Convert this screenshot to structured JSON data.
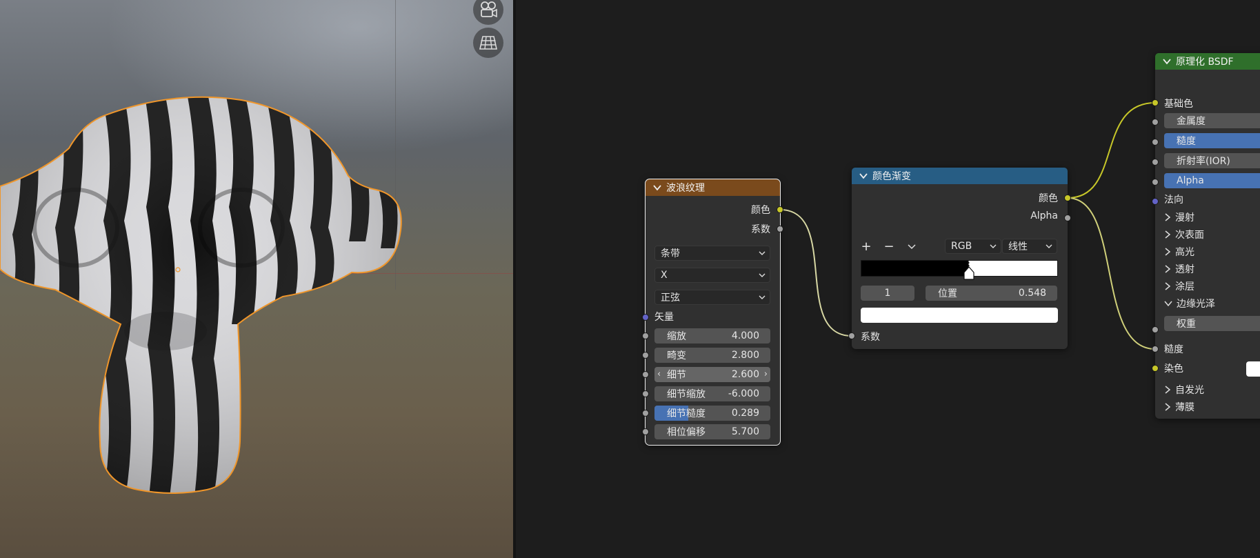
{
  "viewport": {
    "camera_icon": "camera-view-icon",
    "grid_icon": "perspective-grid-icon"
  },
  "wave_node": {
    "title": "波浪纹理",
    "outputs": [
      "颜色",
      "系数"
    ],
    "dropdowns": [
      "条带",
      "X",
      "正弦"
    ],
    "vector_input": "矢量",
    "fields": [
      {
        "label": "缩放",
        "value": "4.000"
      },
      {
        "label": "畸变",
        "value": "2.800"
      },
      {
        "label": "细节",
        "value": "2.600"
      },
      {
        "label": "细节缩放",
        "value": "-6.000"
      },
      {
        "label": "细节糙度",
        "value": "0.289"
      },
      {
        "label": "相位偏移",
        "value": "5.700"
      }
    ],
    "detail_roughness_fill": 0.289
  },
  "ramp_node": {
    "title": "颜色渐变",
    "outputs": [
      "颜色",
      "Alpha"
    ],
    "add_btn": "+",
    "remove_btn": "−",
    "color_mode": "RGB",
    "interpolation": "线性",
    "stop_index": "1",
    "position_label": "位置",
    "position_value": "0.548",
    "input": "系数",
    "ramp_split": 0.548
  },
  "bsdf_node": {
    "title": "原理化 BSDF",
    "base_color": "基础色",
    "metallic": "金属度",
    "roughness": "糙度",
    "ior": "折射率(IOR)",
    "alpha": "Alpha",
    "normal": "法向",
    "panels": [
      "漫射",
      "次表面",
      "高光",
      "透射",
      "涂层"
    ],
    "sheen_panel": "边缘光泽",
    "sheen_weight": "权重",
    "sheen_roughness": "糙度",
    "sheen_tint": "染色",
    "more_panels": [
      "自发光",
      "薄膜"
    ]
  },
  "colors": {
    "wave_header": "#7a4a1c",
    "ramp_header": "#275d84",
    "bsdf_header": "#2f6f2b",
    "socket_yellow": "#c7c729",
    "socket_gray": "#a1a1a1",
    "socket_purple": "#6363c7",
    "selected_blue": "#4772b3"
  }
}
